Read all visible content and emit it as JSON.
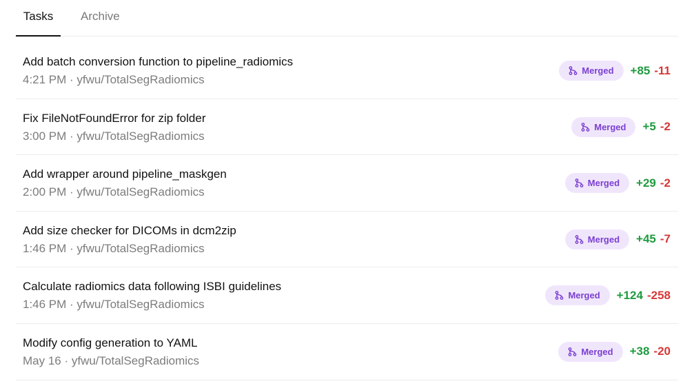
{
  "tabs": [
    {
      "label": "Tasks",
      "active": true
    },
    {
      "label": "Archive",
      "active": false
    }
  ],
  "colors": {
    "badge_bg": "#f0e6fc",
    "badge_text": "#7b3fd1",
    "additions": "#1f9b3f",
    "deletions": "#d63838"
  },
  "badge_icon": "git-merge-icon",
  "tasks": [
    {
      "title": "Add batch conversion function to pipeline_radiomics",
      "meta": "4:21 PM · yfwu/TotalSegRadiomics",
      "status": "Merged",
      "additions": "+85",
      "deletions": "-11"
    },
    {
      "title": "Fix FileNotFoundError for zip folder",
      "meta": "3:00 PM · yfwu/TotalSegRadiomics",
      "status": "Merged",
      "additions": "+5",
      "deletions": "-2"
    },
    {
      "title": "Add wrapper around pipeline_maskgen",
      "meta": "2:00 PM · yfwu/TotalSegRadiomics",
      "status": "Merged",
      "additions": "+29",
      "deletions": "-2"
    },
    {
      "title": "Add size checker for DICOMs in dcm2zip",
      "meta": "1:46 PM · yfwu/TotalSegRadiomics",
      "status": "Merged",
      "additions": "+45",
      "deletions": "-7"
    },
    {
      "title": "Calculate radiomics data following ISBI guidelines",
      "meta": "1:46 PM · yfwu/TotalSegRadiomics",
      "status": "Merged",
      "additions": "+124",
      "deletions": "-258"
    },
    {
      "title": "Modify config generation to YAML",
      "meta": "May 16 · yfwu/TotalSegRadiomics",
      "status": "Merged",
      "additions": "+38",
      "deletions": "-20"
    }
  ]
}
